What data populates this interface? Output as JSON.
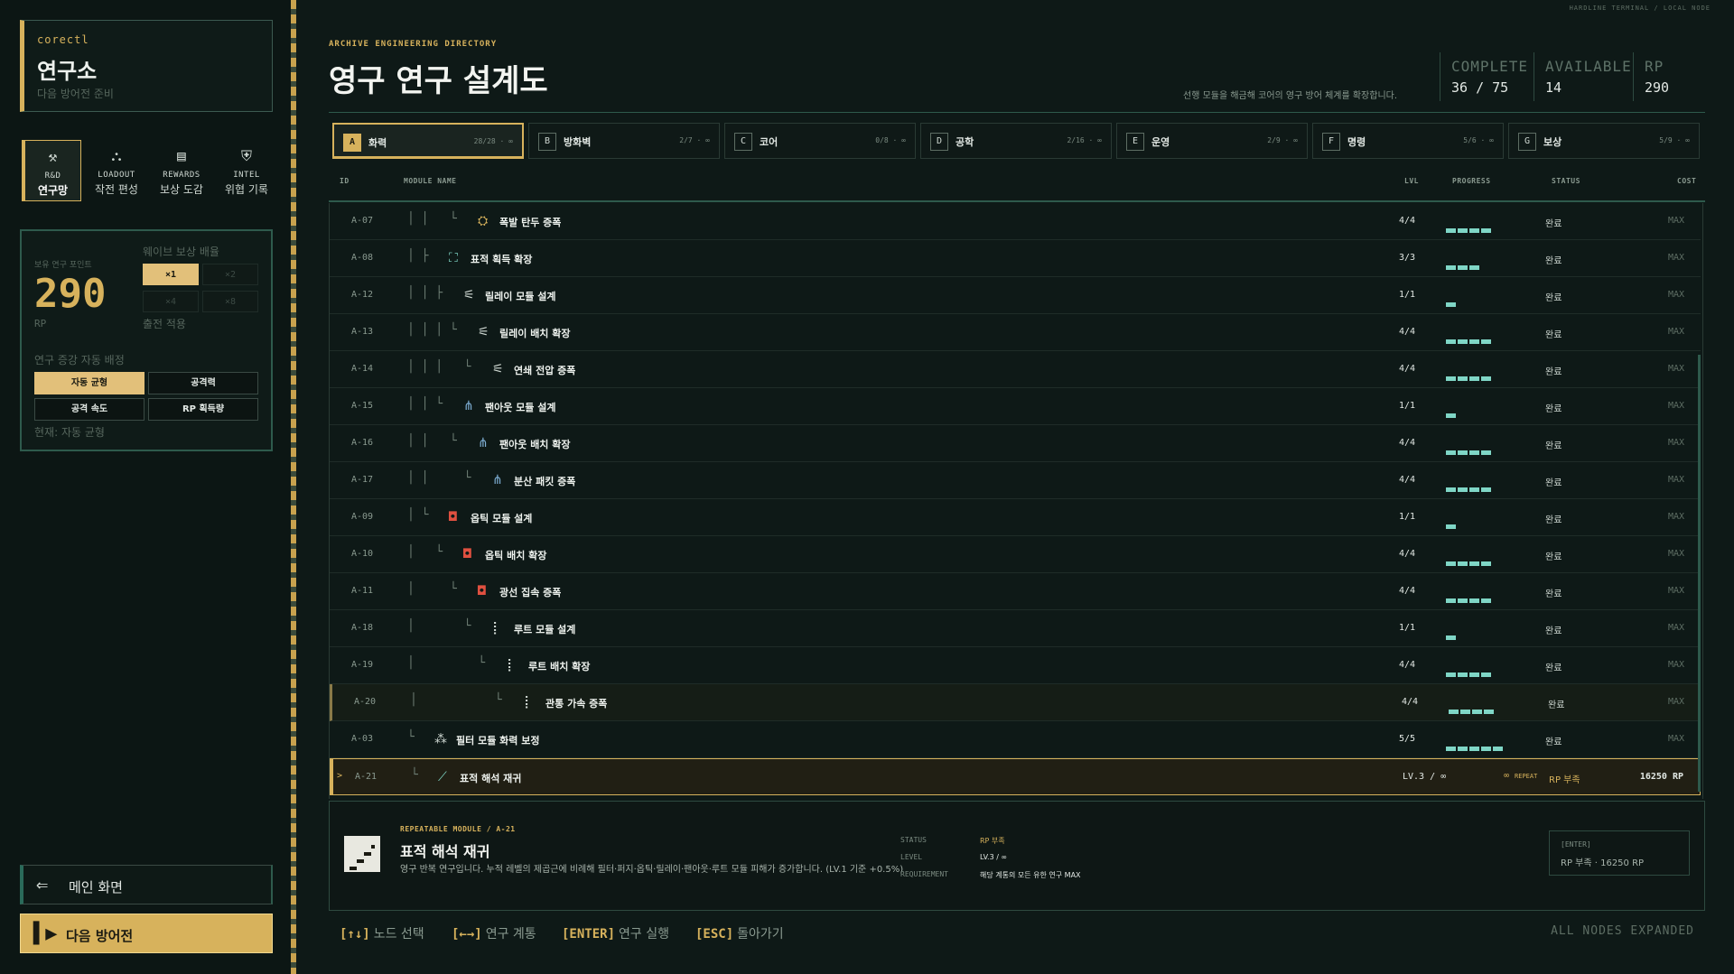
{
  "top_note": "HARDLINE TERMINAL / LOCAL NODE",
  "sidebar": {
    "user": "corectl",
    "title": "연구소",
    "subtitle": "다음 방어전 준비",
    "nav": [
      {
        "en": "R&D",
        "ko": "연구망",
        "icon": "rnd-icon",
        "active": true
      },
      {
        "en": "LOADOUT",
        "ko": "작전 편성",
        "icon": "loadout-icon",
        "active": false
      },
      {
        "en": "REWARDS",
        "ko": "보상 도감",
        "icon": "rewards-icon",
        "active": false
      },
      {
        "en": "INTEL",
        "ko": "위협 기록",
        "icon": "intel-icon",
        "active": false
      }
    ],
    "rp": {
      "label": "보유 연구 포인트",
      "value": "290",
      "unit": "RP",
      "wave_label": "웨이브 보상 배율",
      "multipliers": [
        "×1",
        "×2",
        "×4",
        "×8"
      ],
      "active_multiplier": 0,
      "apply_label": "출전 적용",
      "auto_label": "연구 증강 자동 배정",
      "auto_buttons": [
        "자동 균형",
        "공격력",
        "공격 속도",
        "RP 획득량"
      ],
      "active_auto": 0,
      "current": "현재: 자동 균형"
    },
    "main_button": "메인 화면",
    "next_button": "다음 방어전"
  },
  "header": {
    "category": "ARCHIVE ENGINEERING DIRECTORY",
    "title": "영구 연구 설계도",
    "description": "선행 모듈을 해금해 코어의 영구 방어 체계를 확장합니다.",
    "stats": [
      {
        "k": "COMPLETE",
        "v": "36 / 75"
      },
      {
        "k": "AVAILABLE",
        "v": "14"
      },
      {
        "k": "RP",
        "v": "290"
      }
    ]
  },
  "tabs": [
    {
      "letter": "A",
      "name": "화력",
      "count": "28/28 · ∞",
      "active": true
    },
    {
      "letter": "B",
      "name": "방화벽",
      "count": "2/7 · ∞",
      "active": false
    },
    {
      "letter": "C",
      "name": "코어",
      "count": "0/8 · ∞",
      "active": false
    },
    {
      "letter": "D",
      "name": "공학",
      "count": "2/16 · ∞",
      "active": false
    },
    {
      "letter": "E",
      "name": "운영",
      "count": "2/9 · ∞",
      "active": false
    },
    {
      "letter": "F",
      "name": "명령",
      "count": "5/6 · ∞",
      "active": false
    },
    {
      "letter": "G",
      "name": "보상",
      "count": "5/9 · ∞",
      "active": false
    }
  ],
  "columns": {
    "id": "ID",
    "name": "MODULE NAME",
    "lvl": "LVL",
    "progress": "PROGRESS",
    "status": "STATUS",
    "cost": "COST"
  },
  "rows": [
    {
      "id": "A-07",
      "tree": "│ │   └",
      "depth": 3,
      "icon": "explosive-icon",
      "glyph": "⛭",
      "color": "#d7b25c",
      "name": "폭발 탄두 증폭",
      "lvl": "4/4",
      "progress": 4,
      "status": "완료",
      "cost": "MAX"
    },
    {
      "id": "A-08",
      "tree": "│ ├",
      "depth": 1,
      "icon": "target-acquire-icon",
      "glyph": "⛶",
      "color": "#7fd6c6",
      "name": "표적 획득 확장",
      "lvl": "3/3",
      "progress": 3,
      "status": "완료",
      "cost": "MAX"
    },
    {
      "id": "A-12",
      "tree": "│ │ ├",
      "depth": 2,
      "icon": "relay-icon",
      "glyph": "⚟",
      "color": "#cfd8d2",
      "name": "릴레이 모듈 설계",
      "lvl": "1/1",
      "progress": 1,
      "status": "완료",
      "cost": "MAX"
    },
    {
      "id": "A-13",
      "tree": "│ │ │ └",
      "depth": 3,
      "icon": "relay-icon",
      "glyph": "⚟",
      "color": "#cfd8d2",
      "name": "릴레이 배치 확장",
      "lvl": "4/4",
      "progress": 4,
      "status": "완료",
      "cost": "MAX"
    },
    {
      "id": "A-14",
      "tree": "│ │ │   └",
      "depth": 4,
      "icon": "relay-icon",
      "glyph": "⚟",
      "color": "#cfd8d2",
      "name": "연쇄 전압 증폭",
      "lvl": "4/4",
      "progress": 4,
      "status": "완료",
      "cost": "MAX"
    },
    {
      "id": "A-15",
      "tree": "│ │ └",
      "depth": 2,
      "icon": "fanout-icon",
      "glyph": "⋔",
      "color": "#7fb0d6",
      "name": "팬아웃 모듈 설계",
      "lvl": "1/1",
      "progress": 1,
      "status": "완료",
      "cost": "MAX"
    },
    {
      "id": "A-16",
      "tree": "│ │   └",
      "depth": 3,
      "icon": "fanout-icon",
      "glyph": "⋔",
      "color": "#7fb0d6",
      "name": "팬아웃 배치 확장",
      "lvl": "4/4",
      "progress": 4,
      "status": "완료",
      "cost": "MAX"
    },
    {
      "id": "A-17",
      "tree": "│ │     └",
      "depth": 4,
      "icon": "fanout-icon",
      "glyph": "⋔",
      "color": "#7fb0d6",
      "name": "분산 패킷 증폭",
      "lvl": "4/4",
      "progress": 4,
      "status": "완료",
      "cost": "MAX"
    },
    {
      "id": "A-09",
      "tree": "│ └",
      "depth": 1,
      "icon": "optic-icon",
      "glyph": "◘",
      "color": "#e05040",
      "name": "옵틱 모듈 설계",
      "lvl": "1/1",
      "progress": 1,
      "status": "완료",
      "cost": "MAX"
    },
    {
      "id": "A-10",
      "tree": "│   └",
      "depth": 2,
      "icon": "optic-icon",
      "glyph": "◘",
      "color": "#e05040",
      "name": "옵틱 배치 확장",
      "lvl": "4/4",
      "progress": 4,
      "status": "완료",
      "cost": "MAX"
    },
    {
      "id": "A-11",
      "tree": "│     └",
      "depth": 3,
      "icon": "optic-icon",
      "glyph": "◘",
      "color": "#e05040",
      "name": "광선 집속 증폭",
      "lvl": "4/4",
      "progress": 4,
      "status": "완료",
      "cost": "MAX"
    },
    {
      "id": "A-18",
      "tree": "│       └",
      "depth": 4,
      "icon": "root-icon",
      "glyph": "⡇",
      "color": "#cfd8d2",
      "name": "루트 모듈 설계",
      "lvl": "1/1",
      "progress": 1,
      "status": "완료",
      "cost": "MAX"
    },
    {
      "id": "A-19",
      "tree": "│         └",
      "depth": 5,
      "icon": "root-icon",
      "glyph": "⡇",
      "color": "#cfd8d2",
      "name": "루트 배치 확장",
      "lvl": "4/4",
      "progress": 4,
      "status": "완료",
      "cost": "MAX"
    },
    {
      "id": "A-20",
      "tree": "│           └",
      "depth": 6,
      "icon": "root-icon",
      "glyph": "⡇",
      "color": "#cfd8d2",
      "name": "관통 가속 증폭",
      "lvl": "4/4",
      "progress": 4,
      "status": "완료",
      "cost": "MAX",
      "highlight": true
    },
    {
      "id": "A-03",
      "tree": "└",
      "depth": 1,
      "icon": "filter-icon",
      "glyph": "⁂",
      "color": "#cfd8d2",
      "name": "필터 모듈 화력 보정",
      "lvl": "5/5",
      "progress": 5,
      "status": "완료",
      "cost": "MAX"
    },
    {
      "id": "A-21",
      "tree": "└",
      "depth": 1,
      "icon": "staircase-icon",
      "glyph": "⟋",
      "color": "#7fd6c6",
      "name": "표적 해석 재귀",
      "lvl": "LV.3 / ∞",
      "repeat": "REPEAT",
      "status": "RP 부족",
      "cost": "16250 RP",
      "selected": true,
      "sel_mark": ">"
    }
  ],
  "detail": {
    "category": "REPEATABLE MODULE / A-21",
    "name": "표적 해석 재귀",
    "text": "영구 반복 연구입니다. 누적 레벨의 제곱근에 비례해 필터·퍼지·옵틱·릴레이·팬아웃·루트 모듈 피해가 증가합니다. (LV.1 기준 +0.5%)",
    "status_k": "STATUS",
    "status_v": "RP 부족",
    "level_k": "LEVEL",
    "level_v": "LV.3 / ∞",
    "req_k": "REQUIREMENT",
    "req_v": "해당 계통의 모든 유한 연구 MAX",
    "enter_k": "[ENTER]",
    "enter_v": "RP 부족 · 16250 RP"
  },
  "footer": {
    "hints": [
      {
        "key": "[↑↓]",
        "label": "노드 선택"
      },
      {
        "key": "[←→]",
        "label": "연구 계통"
      },
      {
        "key": "[ENTER]",
        "label": "연구 실행"
      },
      {
        "key": "[ESC]",
        "label": "돌아가기"
      }
    ],
    "right": "ALL NODES EXPANDED"
  }
}
